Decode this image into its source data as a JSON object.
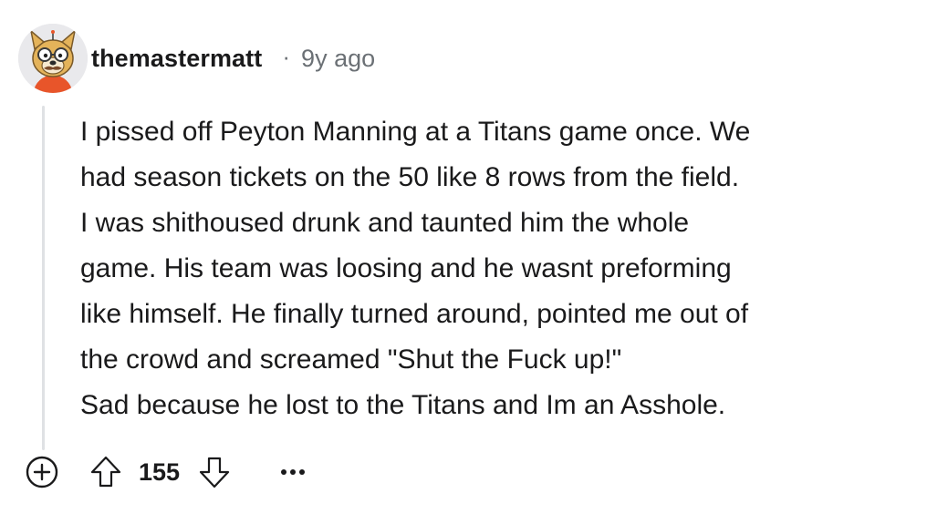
{
  "comment": {
    "author": "themastermatt",
    "separator": "·",
    "timestamp": "9y ago",
    "avatar_icon": "doge-avatar-icon",
    "body_lines": [
      "I pissed off Peyton Manning at a Titans game once. We",
      "had season tickets on the 50 like 8 rows from the field.",
      "I was shithoused drunk and taunted him the whole",
      "game. His team was loosing and he wasnt preforming",
      "like himself. He finally turned around, pointed me out of",
      "the crowd and screamed \"Shut the Fuck up!\"",
      "Sad because he lost to the Titans and Im an Asshole."
    ],
    "score": "155"
  },
  "actions": {
    "expand_icon": "plus-circle-icon",
    "upvote_icon": "arrow-up-icon",
    "downvote_icon": "arrow-down-icon",
    "more_icon": "ellipsis-icon"
  },
  "colors": {
    "text": "#1a1a1b",
    "muted": "#6b7075",
    "thread_line": "#dfe1e4"
  }
}
